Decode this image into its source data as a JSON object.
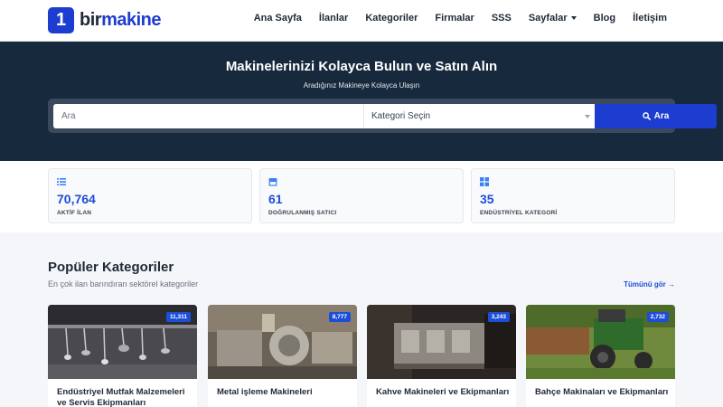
{
  "brand": {
    "digit": "1",
    "name_part1": "bir",
    "name_part2": "makine"
  },
  "nav": {
    "items": [
      "Ana Sayfa",
      "İlanlar",
      "Kategoriler",
      "Firmalar",
      "SSS",
      "Sayfalar",
      "Blog",
      "İletişim"
    ]
  },
  "hero": {
    "title": "Makinelerinizi Kolayca Bulun ve Satın Alın",
    "subtitle": "Aradığınız Makineye Kolayca Ulaşın",
    "search_placeholder": "Ara",
    "category_select": "Kategori Seçin",
    "search_button": "Ara"
  },
  "stats": [
    {
      "value": "70,764",
      "label": "AKTİF İLAN",
      "icon": "list-icon"
    },
    {
      "value": "61",
      "label": "DOĞRULANMIŞ SATICI",
      "icon": "store-icon"
    },
    {
      "value": "35",
      "label": "ENDÜSTRİYEL KATEGORİ",
      "icon": "grid-icon"
    }
  ],
  "popular": {
    "title": "Popüler Kategoriler",
    "subtitle": "En çok ilan barındıran sektörel kategoriler",
    "see_all": "Tümünü gör →",
    "cards": [
      {
        "title": "Endüstriyel Mutfak Malzemeleri ve Servis Ekipmanları",
        "count": "11,311"
      },
      {
        "title": "Metal işleme Makineleri",
        "count": "8,777"
      },
      {
        "title": "Kahve Makineleri ve Ekipmanları",
        "count": "3,243"
      },
      {
        "title": "Bahçe Makinaları ve Ekipmanları",
        "count": "2,732"
      }
    ]
  },
  "colors": {
    "primary": "#1d3cd0",
    "hero_bg": "#17293d",
    "accent_blue": "#1d4ed8"
  }
}
